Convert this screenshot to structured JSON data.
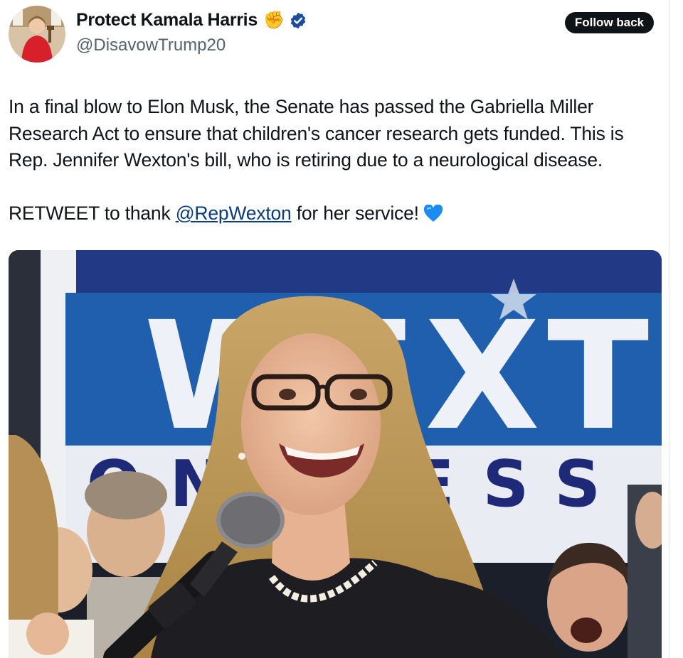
{
  "author": {
    "name": "Protect Kamala Harris",
    "handle": "@DisavowTrump20",
    "name_emoji": "✊",
    "verified_icon": "verified-badge-icon",
    "verified_color": "#1d4e9e"
  },
  "actions": {
    "follow_label": "Follow back"
  },
  "tweet": {
    "line1": "In a final blow to Elon Musk, the Senate has passed the Gabriella Miller",
    "line2": "Research Act to ensure that children's cancer research gets funded. This is",
    "line3": "Rep. Jennifer Wexton's bill, who is retiring due to a neurological disease.",
    "cta_prefix": "RETWEET to thank ",
    "mention": "@RepWexton",
    "cta_suffix": " for her service!",
    "emoji": "💙"
  },
  "photo": {
    "sign_text": "WEXTON",
    "sign_subtext": "ONGRESS"
  },
  "colors": {
    "text": "#0f1419",
    "secondary": "#536471",
    "link": "#0b3c7c",
    "sign_blue": "#1f5fae",
    "heart": "#1d8cf0"
  }
}
